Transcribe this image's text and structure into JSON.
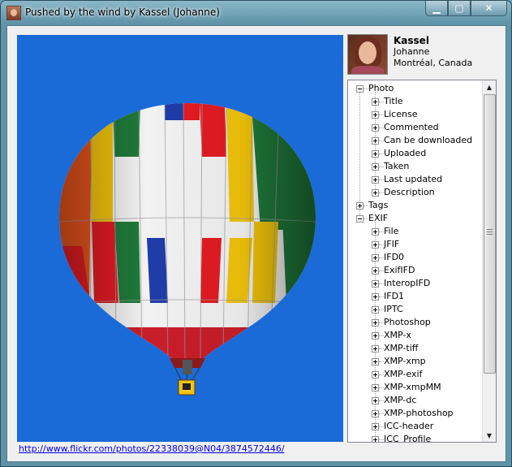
{
  "window": {
    "title": "Pushed by the wind by Kassel (Johanne)",
    "controls": {
      "minimize": "▁",
      "maximize": "▢",
      "close": "✕"
    }
  },
  "photo": {
    "subject": "hot air balloon",
    "link": "http://www.flickr.com/photos/22338039@N04/3874572446/"
  },
  "owner": {
    "username": "Kassel",
    "realname": "Johanne",
    "location": "Montréal, Canada"
  },
  "tree": {
    "nodes": [
      {
        "label": "Photo",
        "level": 0,
        "expanded": true
      },
      {
        "label": "Title",
        "level": 1,
        "expanded": false
      },
      {
        "label": "License",
        "level": 1,
        "expanded": false
      },
      {
        "label": "Commented",
        "level": 1,
        "expanded": false
      },
      {
        "label": "Can be downloaded",
        "level": 1,
        "expanded": false
      },
      {
        "label": "Uploaded",
        "level": 1,
        "expanded": false
      },
      {
        "label": "Taken",
        "level": 1,
        "expanded": false
      },
      {
        "label": "Last updated",
        "level": 1,
        "expanded": false
      },
      {
        "label": "Description",
        "level": 1,
        "expanded": false
      },
      {
        "label": "Tags",
        "level": 0,
        "expanded": false
      },
      {
        "label": "EXIF",
        "level": 0,
        "expanded": true
      },
      {
        "label": "File",
        "level": 1,
        "expanded": false
      },
      {
        "label": "JFIF",
        "level": 1,
        "expanded": false
      },
      {
        "label": "IFD0",
        "level": 1,
        "expanded": false
      },
      {
        "label": "ExifIFD",
        "level": 1,
        "expanded": false
      },
      {
        "label": "InteropIFD",
        "level": 1,
        "expanded": false
      },
      {
        "label": "IFD1",
        "level": 1,
        "expanded": false
      },
      {
        "label": "IPTC",
        "level": 1,
        "expanded": false
      },
      {
        "label": "Photoshop",
        "level": 1,
        "expanded": false
      },
      {
        "label": "XMP-x",
        "level": 1,
        "expanded": false
      },
      {
        "label": "XMP-tiff",
        "level": 1,
        "expanded": false
      },
      {
        "label": "XMP-xmp",
        "level": 1,
        "expanded": false
      },
      {
        "label": "XMP-exif",
        "level": 1,
        "expanded": false
      },
      {
        "label": "XMP-xmpMM",
        "level": 1,
        "expanded": false
      },
      {
        "label": "XMP-dc",
        "level": 1,
        "expanded": false
      },
      {
        "label": "XMP-photoshop",
        "level": 1,
        "expanded": false
      },
      {
        "label": "ICC-header",
        "level": 1,
        "expanded": false
      },
      {
        "label": "ICC_Profile",
        "level": 1,
        "expanded": false
      }
    ],
    "scroll_up_icon": "▲",
    "scroll_down_icon": "▼"
  },
  "colors": {
    "sky": "#1a6ad8",
    "link": "#0000ee"
  }
}
